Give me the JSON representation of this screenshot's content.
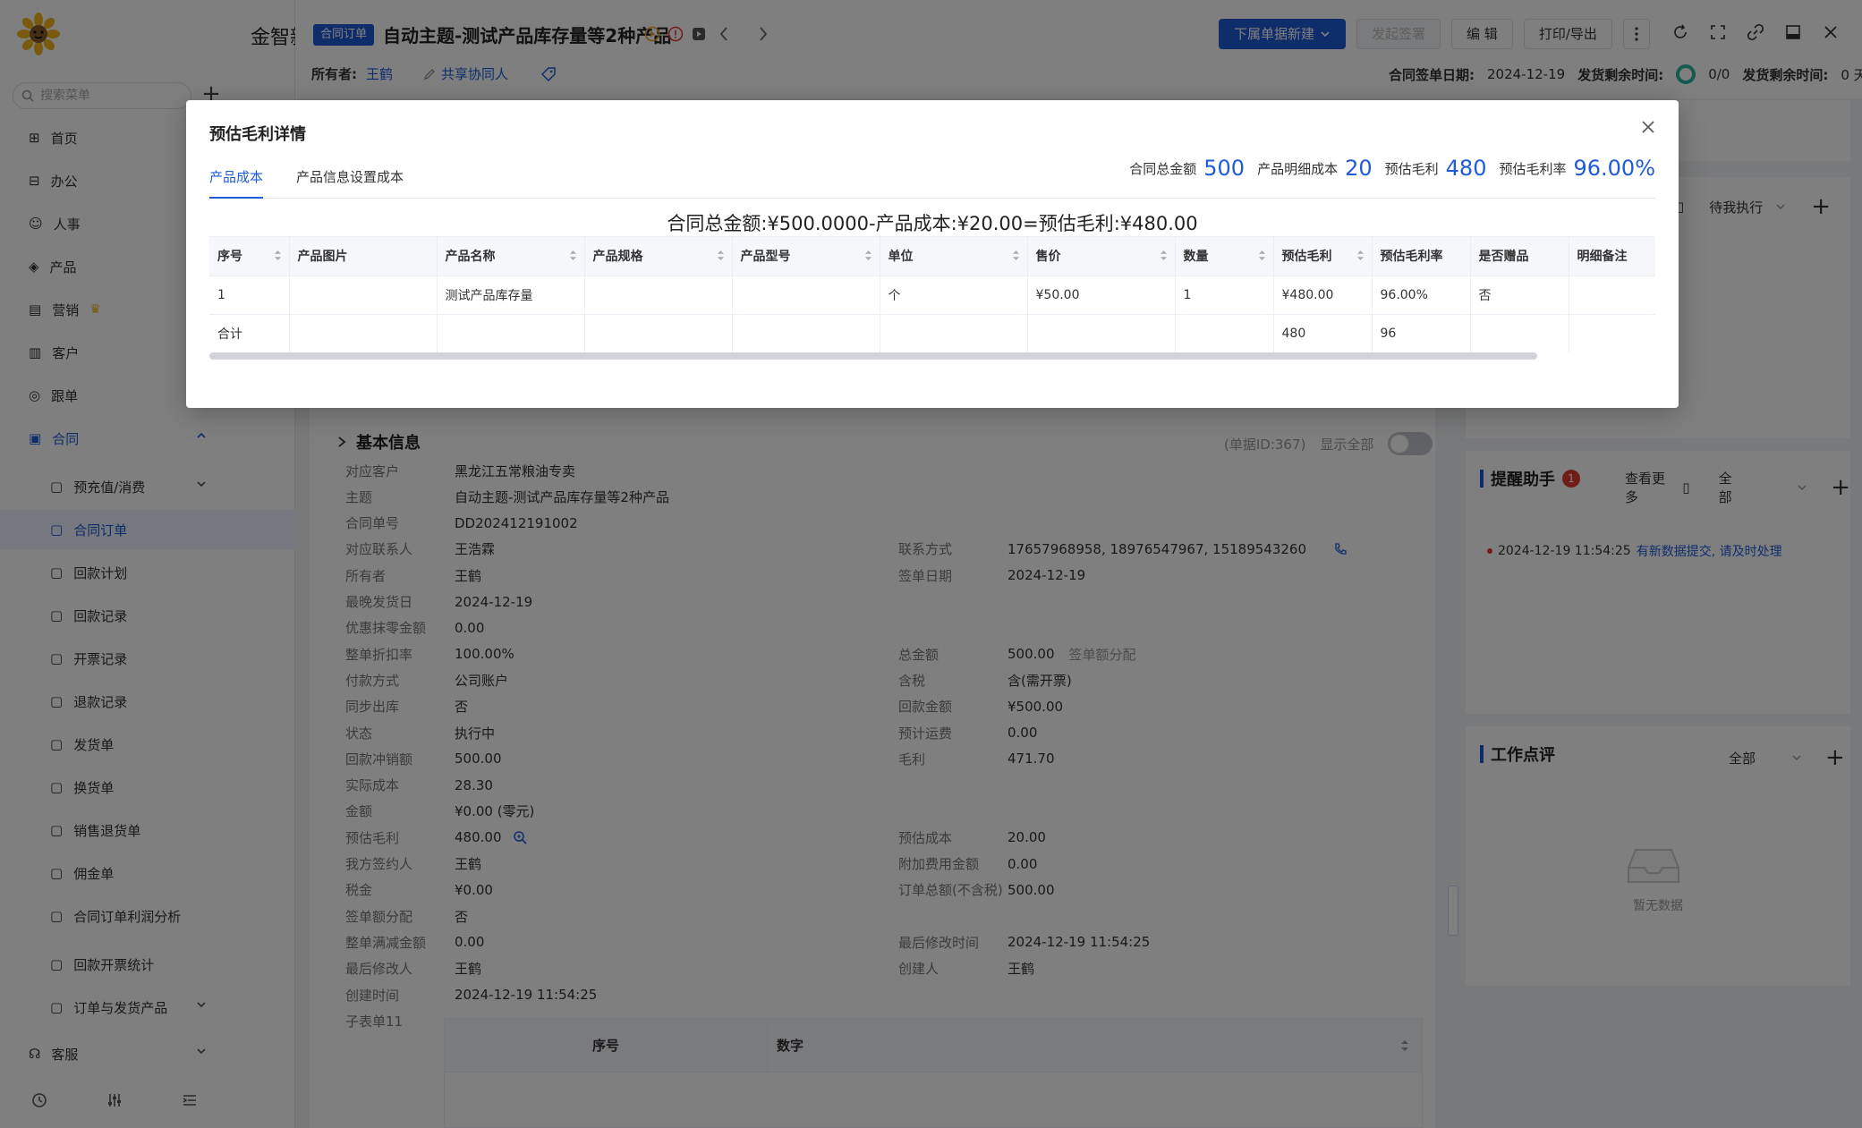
{
  "sidebar": {
    "brand": "金智新",
    "search_placeholder": "搜索菜单",
    "items": [
      {
        "label": "首页"
      },
      {
        "label": "办公"
      },
      {
        "label": "人事"
      },
      {
        "label": "产品"
      },
      {
        "label": "营销"
      },
      {
        "label": "客户"
      },
      {
        "label": "跟单"
      },
      {
        "label": "合同"
      }
    ],
    "contract_sub": [
      {
        "label": "预充值/消费"
      },
      {
        "label": "合同订单"
      },
      {
        "label": "回款计划"
      },
      {
        "label": "回款记录"
      },
      {
        "label": "开票记录"
      },
      {
        "label": "退款记录"
      },
      {
        "label": "发货单"
      },
      {
        "label": "换货单"
      },
      {
        "label": "销售退货单"
      },
      {
        "label": "佣金单"
      },
      {
        "label": "合同订单利润分析"
      },
      {
        "label": "回款开票统计"
      },
      {
        "label": "订单与发货产品"
      }
    ],
    "after": [
      {
        "label": "客服"
      }
    ]
  },
  "header": {
    "tag": "合同订单",
    "title": "自动主题-测试产品库存量等2种产品",
    "buttons": {
      "new_from": "下属单据新建",
      "sign": "发起签署",
      "edit": "编 辑",
      "print": "打印/导出"
    },
    "owner_label": "所有者:",
    "owner": "王鹤",
    "share": "共享协同人",
    "sign_date_label": "合同签单日期:",
    "sign_date": "2024-12-19",
    "ship_remain_label": "发货剩余时间:",
    "ship_count": "0/0",
    "ship_remain_label2": "发货剩余时间:",
    "ship_days": "0 天"
  },
  "basic": {
    "title": "基本信息",
    "doc_id": "(单据ID:367)",
    "show_all": "显示全部",
    "left": [
      {
        "k": "对应客户",
        "v": "黑龙江五常粮油专卖",
        "style": "blue"
      },
      {
        "k": "主题",
        "v": "自动主题-测试产品库存量等2种产品"
      },
      {
        "k": "合同单号",
        "v": "DD202412191002"
      },
      {
        "k": "对应联系人",
        "v": "王浩霖",
        "style": "blue"
      },
      {
        "k": "所有者",
        "v": "王鹤"
      },
      {
        "k": "最晚发货日",
        "v": "2024-12-19"
      },
      {
        "k": "优惠抹零金额",
        "v": "0.00"
      },
      {
        "k": "整单折扣率",
        "v": "100.00%"
      },
      {
        "k": "付款方式",
        "v": "公司账户"
      },
      {
        "k": "同步出库",
        "v": "否"
      },
      {
        "k": "状态",
        "v": "执行中",
        "style": "orange"
      },
      {
        "k": "回款冲销额",
        "v": "500.00"
      },
      {
        "k": "实际成本",
        "v": "28.30"
      },
      {
        "k": "金额",
        "v": "¥0.00 (零元)"
      },
      {
        "k": "预估毛利",
        "v": "480.00"
      },
      {
        "k": "我方签约人",
        "v": "王鹤"
      },
      {
        "k": "税金",
        "v": "¥0.00"
      },
      {
        "k": "签单额分配",
        "v": "否"
      },
      {
        "k": "整单满减金额",
        "v": "0.00"
      },
      {
        "k": "最后修改人",
        "v": "王鹤"
      },
      {
        "k": "创建时间",
        "v": "2024-12-19 11:54:25"
      },
      {
        "k": "子表单11",
        "v": ""
      }
    ],
    "right": [
      {
        "k": "联系方式",
        "v": "17657968958, 18976547967, 15189543260",
        "row": 3
      },
      {
        "k": "签单日期",
        "v": "2024-12-19",
        "row": 4
      },
      {
        "k": "总金额",
        "v": "500.00",
        "extra": "签单额分配",
        "row": 7
      },
      {
        "k": "含税",
        "v": "含(需开票)",
        "row": 8
      },
      {
        "k": "回款金额",
        "v": "¥500.00",
        "row": 9
      },
      {
        "k": "预计运费",
        "v": "0.00",
        "row": 10
      },
      {
        "k": "毛利",
        "v": "471.70",
        "row": 11
      },
      {
        "k": "预估成本",
        "v": "20.00",
        "row": 14
      },
      {
        "k": "附加费用金额",
        "v": "0.00",
        "row": 15
      },
      {
        "k": "订单总额(不含税)",
        "v": "500.00",
        "row": 16
      },
      {
        "k": "最后修改时间",
        "v": "2024-12-19 11:54:25",
        "row": 18
      },
      {
        "k": "创建人",
        "v": "王鹤",
        "row": 19
      }
    ],
    "subtable_headers": [
      "序号",
      "数字"
    ]
  },
  "right_panel": {
    "todo_filter": "待我执行",
    "reminder_title": "提醒助手",
    "reminder_badge": "1",
    "reminder_more": "查看更多",
    "reminder_filter": "全部",
    "reminder_time": "2024-12-19 11:54:25",
    "reminder_text": "有新数据提交, 请及时处理",
    "review_title": "工作点评",
    "review_filter": "全部",
    "review_empty": "暂无数据"
  },
  "modal": {
    "title": "预估毛利详情",
    "tabs": [
      "产品成本",
      "产品信息设置成本"
    ],
    "stats": [
      {
        "k": "合同总金额",
        "v": "500"
      },
      {
        "k": "产品明细成本",
        "v": "20"
      },
      {
        "k": "预估毛利",
        "v": "480"
      },
      {
        "k": "预估毛利率",
        "v": "96.00%"
      }
    ],
    "formula": "合同总金额:¥500.0000-产品成本:¥20.00=预估毛利:¥480.00",
    "columns": [
      "序号",
      "产品图片",
      "产品名称",
      "产品规格",
      "产品型号",
      "单位",
      "售价",
      "数量",
      "预估毛利",
      "预估毛利率",
      "是否赠品",
      "明细备注"
    ],
    "rows": [
      [
        "1",
        "",
        "测试产品库存量",
        "",
        "",
        "个",
        "¥50.00",
        "1",
        "¥480.00",
        "96.00%",
        "否",
        ""
      ],
      [
        "合计",
        "",
        "",
        "",
        "",
        "",
        "",
        "",
        "480",
        "96",
        "",
        ""
      ]
    ]
  },
  "colors": {
    "accent": "#1f5bd6",
    "status": "#f0a020"
  }
}
